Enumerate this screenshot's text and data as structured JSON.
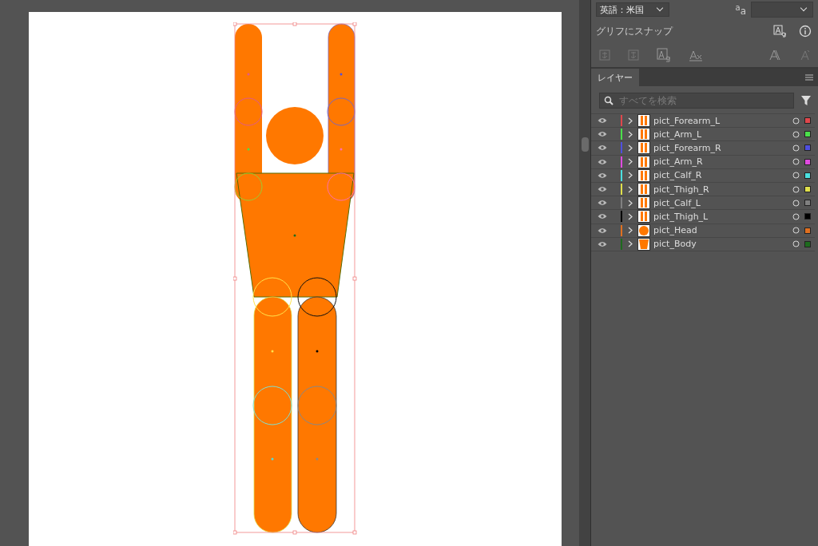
{
  "character_panel": {
    "language": "英語：米国",
    "snap_label": "グリフにスナップ",
    "size_icon_label": "$^{a}$a"
  },
  "layers_panel": {
    "tabs": [
      {
        "label": "レイヤー",
        "selected": true
      }
    ],
    "search": {
      "placeholder": "すべてを検索"
    },
    "layers": [
      {
        "name": "pict_Forearm_L",
        "color": "#e0474c",
        "kind": "bars"
      },
      {
        "name": "pict_Arm_L",
        "color": "#4be04b",
        "kind": "bars"
      },
      {
        "name": "pict_Forearm_R",
        "color": "#4f4fe0",
        "kind": "bars"
      },
      {
        "name": "pict_Arm_R",
        "color": "#e04be0",
        "kind": "bars"
      },
      {
        "name": "pict_Calf_R",
        "color": "#4be0e0",
        "kind": "bars"
      },
      {
        "name": "pict_Thigh_R",
        "color": "#e0e04b",
        "kind": "bars"
      },
      {
        "name": "pict_Calf_L",
        "color": "#808080",
        "kind": "bars"
      },
      {
        "name": "pict_Thigh_L",
        "color": "#000000",
        "kind": "bars"
      },
      {
        "name": "pict_Head",
        "color": "#e07020",
        "kind": "circle"
      },
      {
        "name": "pict_Body",
        "color": "#1e6b1e",
        "kind": "body"
      }
    ]
  }
}
